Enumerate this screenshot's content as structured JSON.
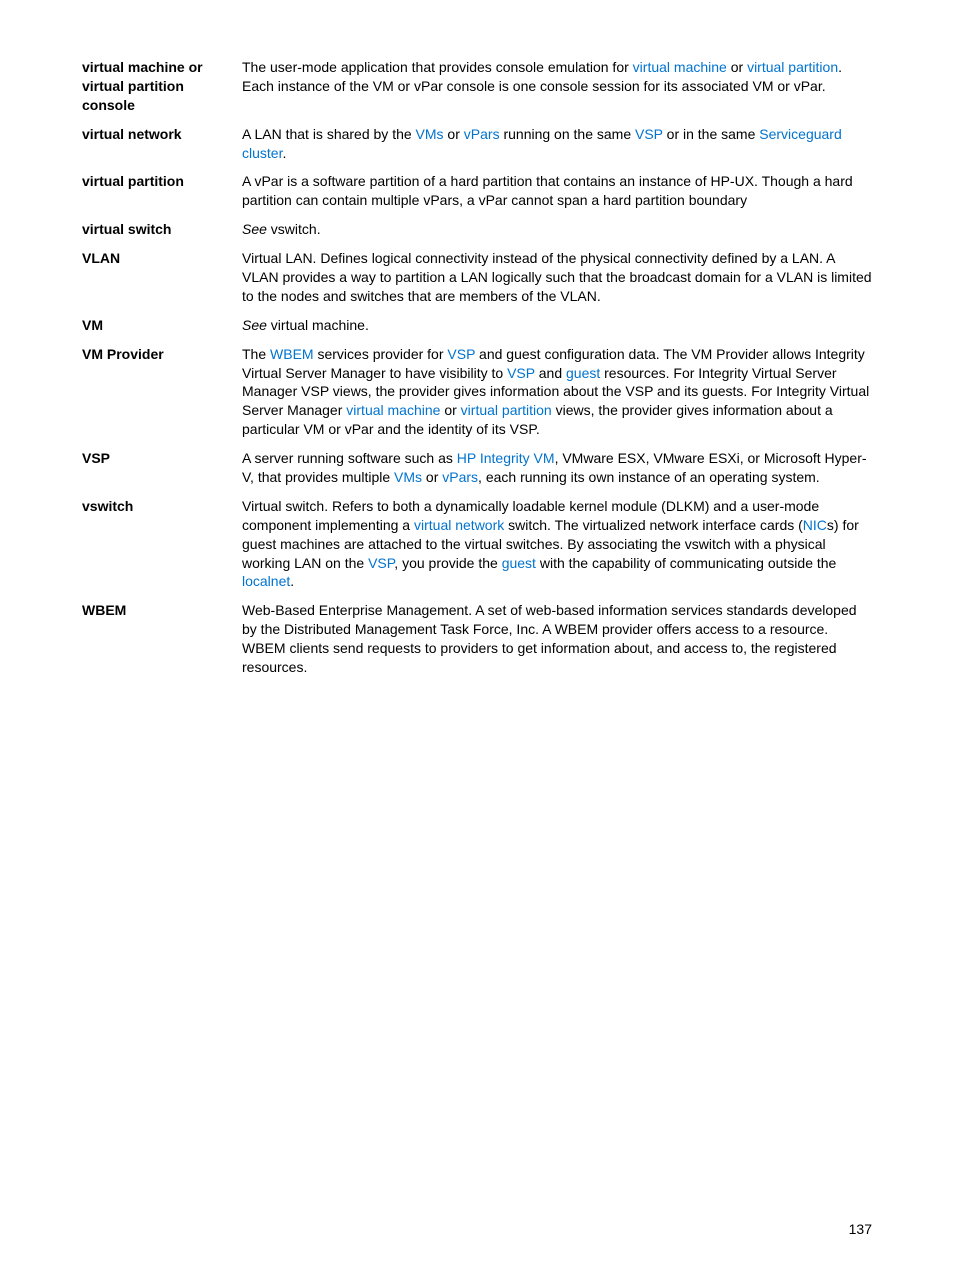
{
  "entries": [
    {
      "term": "virtual machine or virtual partition console",
      "parts": [
        {
          "t": "text",
          "v": "The user-mode application that provides console emulation for "
        },
        {
          "t": "link",
          "v": "virtual machine"
        },
        {
          "t": "text",
          "v": " or "
        },
        {
          "t": "link",
          "v": "virtual partition"
        },
        {
          "t": "text",
          "v": ". Each instance of the VM or vPar console is one console session for its associated VM or vPar."
        }
      ]
    },
    {
      "term": "virtual network",
      "parts": [
        {
          "t": "text",
          "v": "A LAN that is shared by the "
        },
        {
          "t": "link",
          "v": "VMs"
        },
        {
          "t": "text",
          "v": " or "
        },
        {
          "t": "link",
          "v": "vPars"
        },
        {
          "t": "text",
          "v": " running on the same "
        },
        {
          "t": "link",
          "v": "VSP"
        },
        {
          "t": "text",
          "v": " or in the same "
        },
        {
          "t": "link",
          "v": "Serviceguard cluster"
        },
        {
          "t": "text",
          "v": "."
        }
      ]
    },
    {
      "term": "virtual partition",
      "parts": [
        {
          "t": "text",
          "v": "A vPar is a software partition of a hard partition that contains an instance of HP-UX. Though a hard partition can contain multiple vPars, a vPar cannot span a hard partition boundary"
        }
      ]
    },
    {
      "term": "virtual switch",
      "parts": [
        {
          "t": "italic",
          "v": "See"
        },
        {
          "t": "text",
          "v": " vswitch."
        }
      ]
    },
    {
      "term": "VLAN",
      "parts": [
        {
          "t": "text",
          "v": "Virtual LAN. Defines logical connectivity instead of the physical connectivity defined by a LAN. A VLAN provides a way to partition a LAN logically such that the broadcast domain for a VLAN is limited to the nodes and switches that are members of the VLAN."
        }
      ]
    },
    {
      "term": "VM",
      "parts": [
        {
          "t": "italic",
          "v": "See"
        },
        {
          "t": "text",
          "v": " virtual machine."
        }
      ]
    },
    {
      "term": "VM Provider",
      "parts": [
        {
          "t": "text",
          "v": "The "
        },
        {
          "t": "link",
          "v": "WBEM"
        },
        {
          "t": "text",
          "v": " services provider for "
        },
        {
          "t": "link",
          "v": "VSP"
        },
        {
          "t": "text",
          "v": " and guest configuration data. The VM Provider allows Integrity Virtual Server Manager to have visibility to "
        },
        {
          "t": "link",
          "v": "VSP"
        },
        {
          "t": "text",
          "v": " and "
        },
        {
          "t": "link",
          "v": "guest"
        },
        {
          "t": "text",
          "v": " resources. For Integrity Virtual Server Manager VSP views, the provider gives information about the VSP and its guests. For Integrity Virtual Server Manager "
        },
        {
          "t": "link",
          "v": "virtual machine "
        },
        {
          "t": "text",
          "v": " or "
        },
        {
          "t": "link",
          "v": "virtual partition"
        },
        {
          "t": "text",
          "v": " views, the provider gives information about a particular VM or vPar and the identity of its VSP."
        }
      ]
    },
    {
      "term": "VSP",
      "parts": [
        {
          "t": "text",
          "v": "A server running software such as "
        },
        {
          "t": "link",
          "v": "HP Integrity VM"
        },
        {
          "t": "text",
          "v": ", VMware ESX, VMware ESXi, or Microsoft Hyper-V, that provides multiple "
        },
        {
          "t": "link",
          "v": "VMs"
        },
        {
          "t": "text",
          "v": " or "
        },
        {
          "t": "link",
          "v": "vPars"
        },
        {
          "t": "text",
          "v": ", each running its own instance of an operating system."
        }
      ]
    },
    {
      "term": "vswitch",
      "parts": [
        {
          "t": "text",
          "v": "Virtual switch. Refers to both a dynamically loadable kernel module (DLKM) and a user-mode component implementing a "
        },
        {
          "t": "link",
          "v": "virtual network"
        },
        {
          "t": "text",
          "v": " switch. The virtualized network interface cards ("
        },
        {
          "t": "link",
          "v": "NIC"
        },
        {
          "t": "text",
          "v": "s) for guest machines are attached to the virtual switches. By associating the vswitch with a physical working LAN on the "
        },
        {
          "t": "link",
          "v": "VSP"
        },
        {
          "t": "text",
          "v": ", you provide the "
        },
        {
          "t": "link",
          "v": "guest"
        },
        {
          "t": "text",
          "v": " with the capability of communicating outside the "
        },
        {
          "t": "link",
          "v": "localnet"
        },
        {
          "t": "text",
          "v": "."
        }
      ]
    },
    {
      "term": "WBEM",
      "parts": [
        {
          "t": "text",
          "v": "Web-Based Enterprise Management. A set of web-based information services standards developed by the Distributed Management Task Force, Inc. A WBEM provider offers access to a resource. WBEM clients send requests to providers to get information about, and access to, the registered resources."
        }
      ]
    }
  ],
  "pageNumber": "137"
}
